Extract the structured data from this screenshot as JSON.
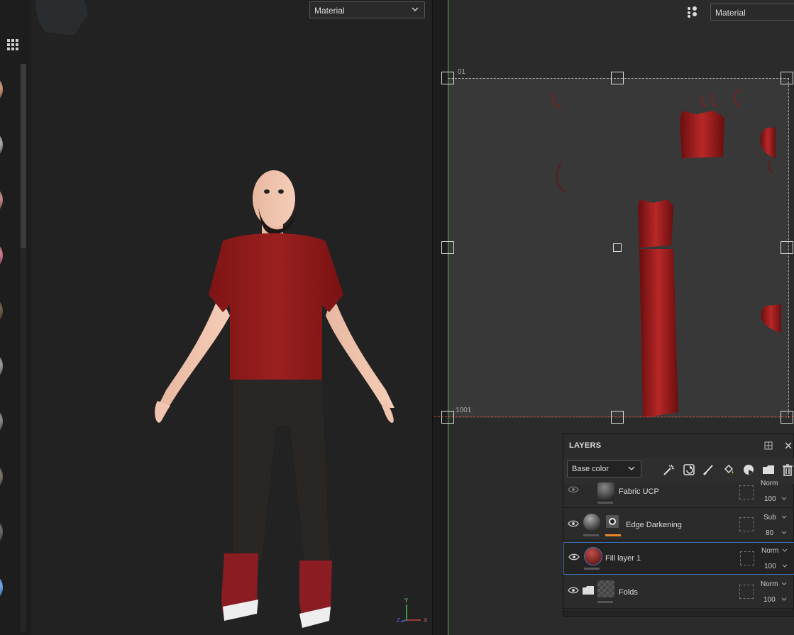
{
  "viewport3d": {
    "material_select": "Material",
    "axis": {
      "y": "Y",
      "x": "X",
      "z": "Z"
    }
  },
  "uv": {
    "material_select": "Material",
    "tile_top_label": "01",
    "tile_bottom_label": "1001"
  },
  "layers": {
    "title": "LAYERS",
    "channel": "Base color",
    "tools": [
      "add-effect-icon",
      "add-fill-icon",
      "paint-icon",
      "fill-bucket-icon",
      "smart-material-icon",
      "folder-icon",
      "delete-icon"
    ],
    "rows": [
      {
        "name": "Fabric UCP",
        "blend": "Norm",
        "opacity": "100"
      },
      {
        "name": "Edge Darkening",
        "blend": "Sub",
        "opacity": "80"
      },
      {
        "name": "Fill layer 1",
        "blend": "Norm",
        "opacity": "100"
      },
      {
        "name": "Folds",
        "blend": "Norm",
        "opacity": "100"
      }
    ]
  },
  "colors": {
    "accent_orange": "#e8842a",
    "selection_blue": "#3b73b8",
    "uv_green": "#3ec13e",
    "shirt_red": "#8c1818"
  }
}
